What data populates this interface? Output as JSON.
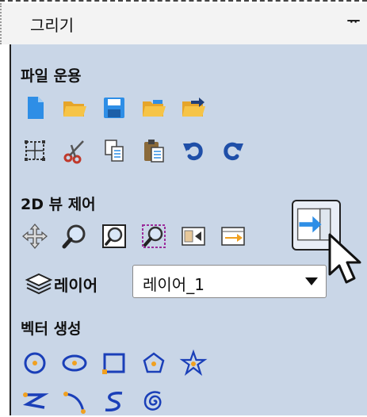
{
  "panel": {
    "title": "그리기",
    "pin_label": "ᅲ"
  },
  "sections": {
    "file": {
      "title": "파일 운용"
    },
    "view2d": {
      "title": "2D 뷰 제어"
    },
    "layer": {
      "label": "레이어",
      "selected": "레이어_1"
    },
    "vector": {
      "title": "벡터 생성"
    }
  },
  "icons": {
    "file_row1": [
      "new-document-icon",
      "open-folder-icon",
      "save-icon",
      "open-folder-alt-icon",
      "import-folder-icon"
    ],
    "file_row2": [
      "select-all-icon",
      "cut-icon",
      "copy-icon",
      "paste-icon",
      "undo-icon",
      "redo-icon"
    ],
    "view_row": [
      "pan-icon",
      "zoom-icon",
      "zoom-extents-icon",
      "zoom-selection-icon",
      "view-toggle-icon",
      "view-import-icon",
      "view-export-icon"
    ],
    "vector_row1": [
      "circle-icon",
      "ellipse-icon",
      "rectangle-icon",
      "polygon-icon",
      "star-icon"
    ],
    "vector_row2": [
      "polyline-icon",
      "arc-icon",
      "curve-icon",
      "spiral-icon"
    ]
  },
  "colors": {
    "panel_bg": "#c9d6e7",
    "accent_blue": "#2e8ee6",
    "folder_orange": "#f3b73b",
    "vector_orange": "#f0a020",
    "vector_stroke": "#1a3fb8",
    "dark_blue": "#1f4fa8"
  }
}
